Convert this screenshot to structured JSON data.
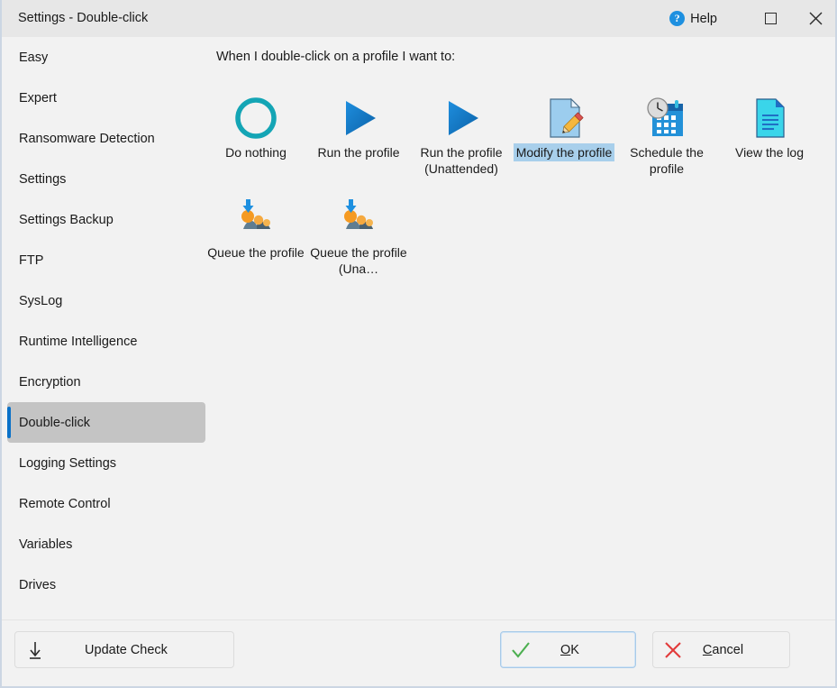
{
  "window": {
    "title": "Settings - Double-click",
    "help_label": "Help",
    "help_icon": "question-circle-icon",
    "maximize_icon": "maximize-square-icon",
    "close_icon": "close-x-icon",
    "accent_color": "#0a71c8",
    "titlebar_color": "#e7e7e7",
    "surface_color": "#f2f2f2"
  },
  "sidebar": {
    "items": [
      {
        "label": "Easy",
        "selected": false
      },
      {
        "label": "Expert",
        "selected": false
      },
      {
        "label": "Ransomware Detection",
        "selected": false
      },
      {
        "label": "Settings",
        "selected": false
      },
      {
        "label": "Settings Backup",
        "selected": false
      },
      {
        "label": "FTP",
        "selected": false
      },
      {
        "label": "SysLog",
        "selected": false
      },
      {
        "label": "Runtime Intelligence",
        "selected": false
      },
      {
        "label": "Encryption",
        "selected": false
      },
      {
        "label": "Double-click",
        "selected": true
      },
      {
        "label": "Logging Settings",
        "selected": false
      },
      {
        "label": "Remote Control",
        "selected": false
      },
      {
        "label": "Variables",
        "selected": false
      },
      {
        "label": "Drives",
        "selected": false
      }
    ],
    "selected_label": "Double-click",
    "selected_bg": "#c4c4c4"
  },
  "main": {
    "prompt": "When I double-click on a profile I want to:",
    "selection_highlight_color": "#a8cfeb",
    "choices": [
      {
        "label": "Do nothing",
        "icon": "empty-circle-icon",
        "selected": false,
        "color": "#14a5b5"
      },
      {
        "label": "Run the profile",
        "icon": "play-triangle-icon",
        "selected": false,
        "color": "#1276c4"
      },
      {
        "label": "Run the profile (Unattended)",
        "icon": "play-triangle-icon",
        "selected": false,
        "color": "#1276c4"
      },
      {
        "label": "Modify the profile",
        "icon": "document-pencil-icon",
        "selected": true,
        "color": "#9ccdee"
      },
      {
        "label": "Schedule the profile",
        "icon": "calendar-clock-icon",
        "selected": false,
        "color": "#1b87d2"
      },
      {
        "label": "View the log",
        "icon": "document-lines-icon",
        "selected": false,
        "color": "#3ad5ea"
      },
      {
        "label": "Queue the profile",
        "icon": "queue-arrow-icon",
        "selected": false,
        "color": "#f59a21"
      },
      {
        "label": "Queue the profile (Una…",
        "icon": "queue-arrow-icon",
        "selected": false,
        "color": "#f59a21"
      }
    ]
  },
  "footer": {
    "update_check": {
      "label": "Update Check",
      "icon": "download-arrow-icon"
    },
    "ok": {
      "label_pre": "",
      "accel": "O",
      "label_post": "K",
      "icon": "check-mark-icon",
      "icon_color": "#4caf50",
      "focused": true
    },
    "cancel": {
      "label_pre": "",
      "accel": "C",
      "label_post": "ancel",
      "icon": "cross-mark-icon",
      "icon_color": "#e23b3b",
      "focused": false
    }
  }
}
